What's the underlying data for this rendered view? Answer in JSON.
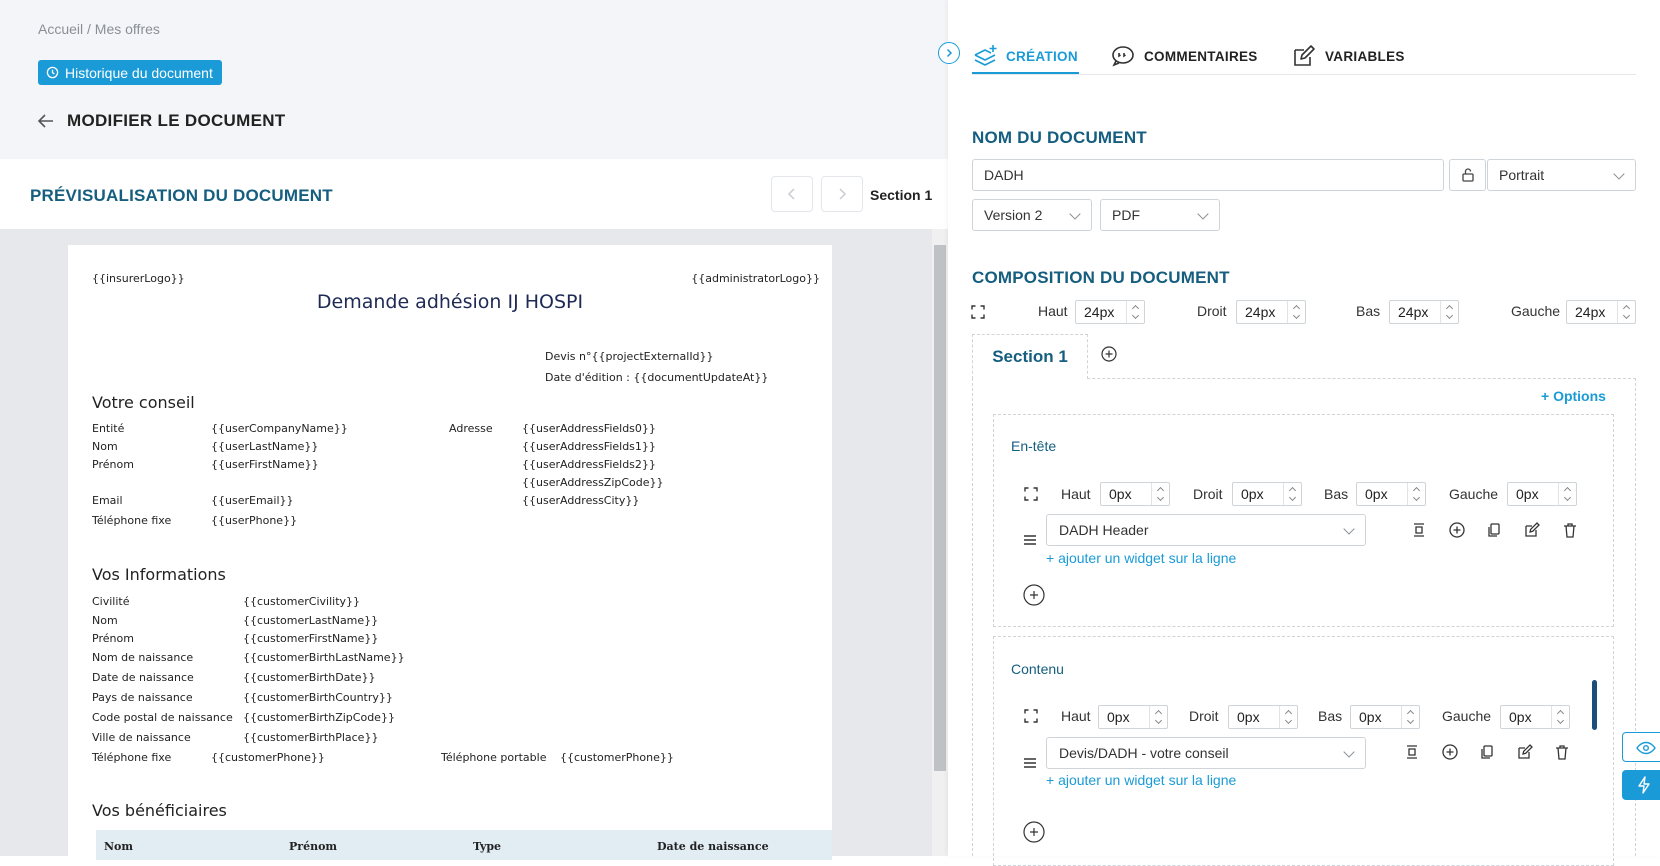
{
  "breadcrumb": "Accueil / Mes offres",
  "history_button": "Historique du document",
  "page_title": "MODIFIER LE DOCUMENT",
  "preview": {
    "title": "PRÉVISUALISATION DU DOCUMENT",
    "section_label": "Section 1",
    "doc": {
      "insurer_logo": "{{insurerLogo}}",
      "admin_logo": "{{administratorLogo}}",
      "title": "Demande adhésion IJ HOSPI",
      "devis": "Devis n°{{projectExternalId}}",
      "date_edition": "Date d'édition : {{documentUpdateAt}}",
      "conseil_heading": "Votre conseil",
      "conseil_rows": [
        {
          "label": "Entité",
          "value": "{{userCompanyName}}"
        },
        {
          "label": "Nom",
          "value": "{{userLastName}}"
        },
        {
          "label": "Prénom",
          "value": "{{userFirstName}}"
        },
        {
          "label": "Email",
          "value": "{{userEmail}}"
        },
        {
          "label": "Téléphone fixe",
          "value": "{{userPhone}}"
        }
      ],
      "adresse_label": "Adresse",
      "adresse_values": [
        "{{userAddressFields0}}",
        "{{userAddressFields1}}",
        "{{userAddressFields2}}",
        "{{userAddressZipCode}}",
        "{{userAddressCity}}"
      ],
      "infos_heading": "Vos Informations",
      "infos_rows": [
        {
          "label": "Civilité",
          "value": "{{customerCivility}}"
        },
        {
          "label": "Nom",
          "value": "{{customerLastName}}"
        },
        {
          "label": "Prénom",
          "value": "{{customerFirstName}}"
        },
        {
          "label": "Nom de naissance",
          "value": "{{customerBirthLastName}}"
        },
        {
          "label": "Date de naissance",
          "value": "{{customerBirthDate}}"
        },
        {
          "label": "Pays de naissance",
          "value": "{{customerBirthCountry}}"
        },
        {
          "label": "Code postal de naissance",
          "value": "{{customerBirthZipCode}}"
        },
        {
          "label": "Ville de naissance",
          "value": "{{customerBirthPlace}}"
        }
      ],
      "phone_fixe_label": "Téléphone fixe",
      "phone_fixe_value": "{{customerPhone}}",
      "phone_port_label": "Téléphone portable",
      "phone_port_value": "{{customerPhone}}",
      "benef_heading": "Vos bénéficiaires",
      "table_headers": [
        "Nom",
        "Prénom",
        "Type",
        "Date de naissance"
      ]
    }
  },
  "tabs": [
    {
      "label": "CRÉATION",
      "icon": "layers-plus-icon",
      "active": true
    },
    {
      "label": "COMMENTAIRES",
      "icon": "comments-icon",
      "active": false
    },
    {
      "label": "VARIABLES",
      "icon": "edit-icon",
      "active": false
    }
  ],
  "doc_name": {
    "heading": "NOM DU DOCUMENT",
    "value": "DADH",
    "orientation": "Portrait",
    "version": "Version 2",
    "format": "PDF"
  },
  "composition": {
    "heading": "COMPOSITION DU DOCUMENT",
    "margins": {
      "haut_label": "Haut",
      "haut": "24px",
      "droit_label": "Droit",
      "droit": "24px",
      "bas_label": "Bas",
      "bas": "24px",
      "gauche_label": "Gauche",
      "gauche": "24px"
    },
    "section_tab": "Section 1",
    "options": "+ Options",
    "header_zone": {
      "label": "En-tête",
      "haut": "0px",
      "droit": "0px",
      "bas": "0px",
      "gauche": "0px",
      "widget": "DADH Header",
      "add_widget": "+ ajouter un widget sur la ligne"
    },
    "content_zone": {
      "label": "Contenu",
      "haut": "0px",
      "droit": "0px",
      "bas": "0px",
      "gauche": "0px",
      "widget": "Devis/DADH - votre conseil",
      "add_widget": "+ ajouter un widget sur la ligne"
    }
  },
  "colors": {
    "accent": "#1a9bd7",
    "heading": "#155e7f"
  }
}
